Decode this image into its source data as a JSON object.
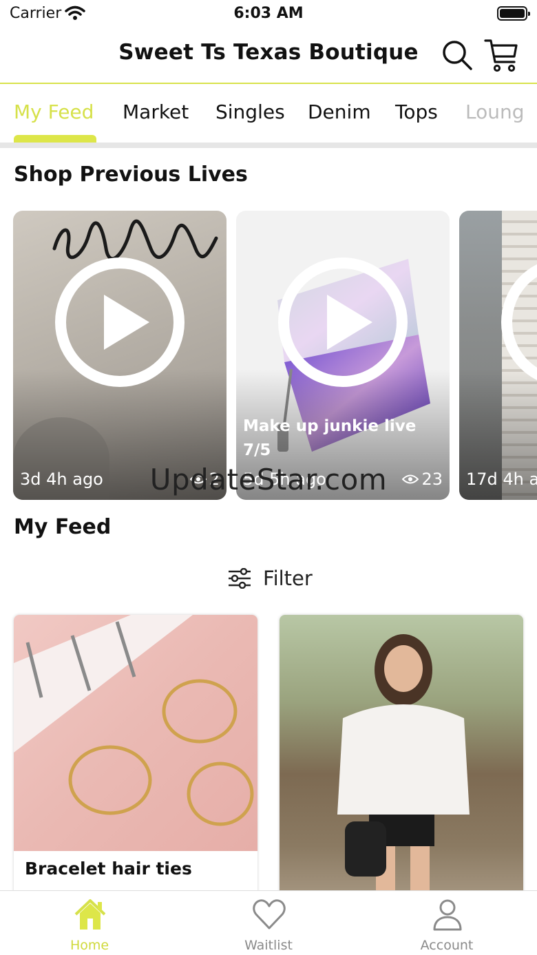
{
  "status_bar": {
    "carrier": "Carrier",
    "time": "6:03 AM"
  },
  "header": {
    "title": "Sweet Ts Texas Boutique"
  },
  "tabs": [
    {
      "label": "My Feed",
      "active": true
    },
    {
      "label": "Market"
    },
    {
      "label": "Singles"
    },
    {
      "label": "Denim"
    },
    {
      "label": "Tops"
    },
    {
      "label": "Loung"
    }
  ],
  "lives_section": {
    "title": "Shop Previous Lives",
    "cards": [
      {
        "title": "",
        "ago": "3d 4h ago",
        "views": "2"
      },
      {
        "title": "Make up junkie live 7/5",
        "ago": "5d 5h ago",
        "views": "23"
      },
      {
        "title": "",
        "ago": "17d 4h a",
        "views": ""
      }
    ]
  },
  "watermark": "UpdateStar.com",
  "feed_section": {
    "title": "My Feed",
    "filter_label": "Filter"
  },
  "products": [
    {
      "name": "Bracelet hair ties"
    },
    {
      "name": ""
    }
  ],
  "bottom_nav": [
    {
      "label": "Home",
      "icon": "home-icon",
      "active": true
    },
    {
      "label": "Waitlist",
      "icon": "heart-icon"
    },
    {
      "label": "Account",
      "icon": "person-icon"
    }
  ],
  "colors": {
    "accent": "#d6e14a",
    "nav_inactive": "#8a8a8a"
  }
}
